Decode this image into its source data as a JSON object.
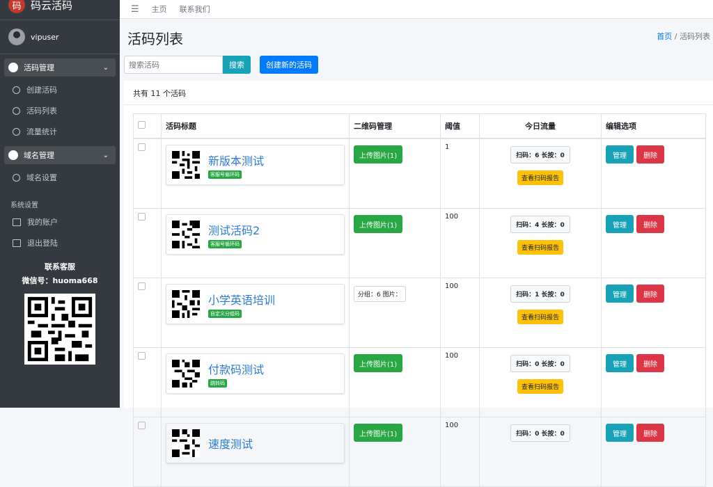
{
  "brand": {
    "logo_char": "码",
    "name": "码云活码"
  },
  "user": {
    "name": "vipuser"
  },
  "sidebar": {
    "group1": {
      "label": "活码管理",
      "items": [
        "创建活码",
        "活码列表",
        "流量统计"
      ]
    },
    "group2": {
      "label": "域名管理",
      "items": [
        "域名设置"
      ]
    },
    "system_label": "系统设置",
    "system_items": [
      "我的账户",
      "退出登陆"
    ],
    "service_title": "联系客服",
    "service_wechat": "微信号：huoma668"
  },
  "topbar": {
    "home": "主页",
    "contact": "联系我们"
  },
  "page": {
    "title": "活码列表",
    "breadcrumb_home": "首页",
    "breadcrumb_sep": "/",
    "breadcrumb_current": "活码列表"
  },
  "search": {
    "placeholder": "搜索活码",
    "button": "搜索",
    "create_button": "创建新的活码"
  },
  "summary": "共有 11 个活码",
  "table": {
    "headers": [
      "活码标题",
      "二维码管理",
      "阈值",
      "今日流量",
      "编辑选项"
    ],
    "rows": [
      {
        "title": "新版本测试",
        "tag": "客服号循环码",
        "qr_action": "上传图片(1)",
        "threshold": "1",
        "stat": "扫码：6  长按：0",
        "report": "查看扫码报告",
        "manage": "管理",
        "delete": "删除"
      },
      {
        "title": "测试活码2",
        "tag": "客服号循环码",
        "qr_action": "上传图片(1)",
        "threshold": "100",
        "stat": "扫码：4  长按：0",
        "report": "查看扫码报告",
        "manage": "管理",
        "delete": "删除"
      },
      {
        "title": "小学英语培训",
        "tag": "自定义分组码",
        "qr_group": "分组：6 图片：",
        "threshold": "100",
        "stat": "扫码：1  长按：0",
        "report": "查看扫码报告",
        "manage": "管理",
        "delete": "删除"
      },
      {
        "title": "付款码测试",
        "tag": "跳转码",
        "qr_action": "上传图片(1)",
        "threshold": "100",
        "stat": "扫码：0  长按：0",
        "report": "查看扫码报告",
        "manage": "管理",
        "delete": "删除"
      },
      {
        "title": "速度测试",
        "tag": "",
        "qr_action": "上传图片(1)",
        "threshold": "100",
        "stat": "扫码：0  长按：0",
        "report": "",
        "manage": "管理",
        "delete": "删除"
      }
    ]
  },
  "colors": {
    "sidebar": "#343a40",
    "primary": "#007bff",
    "info": "#17a2b8",
    "success": "#28a745",
    "warning": "#ffc107",
    "danger": "#dc3545"
  }
}
